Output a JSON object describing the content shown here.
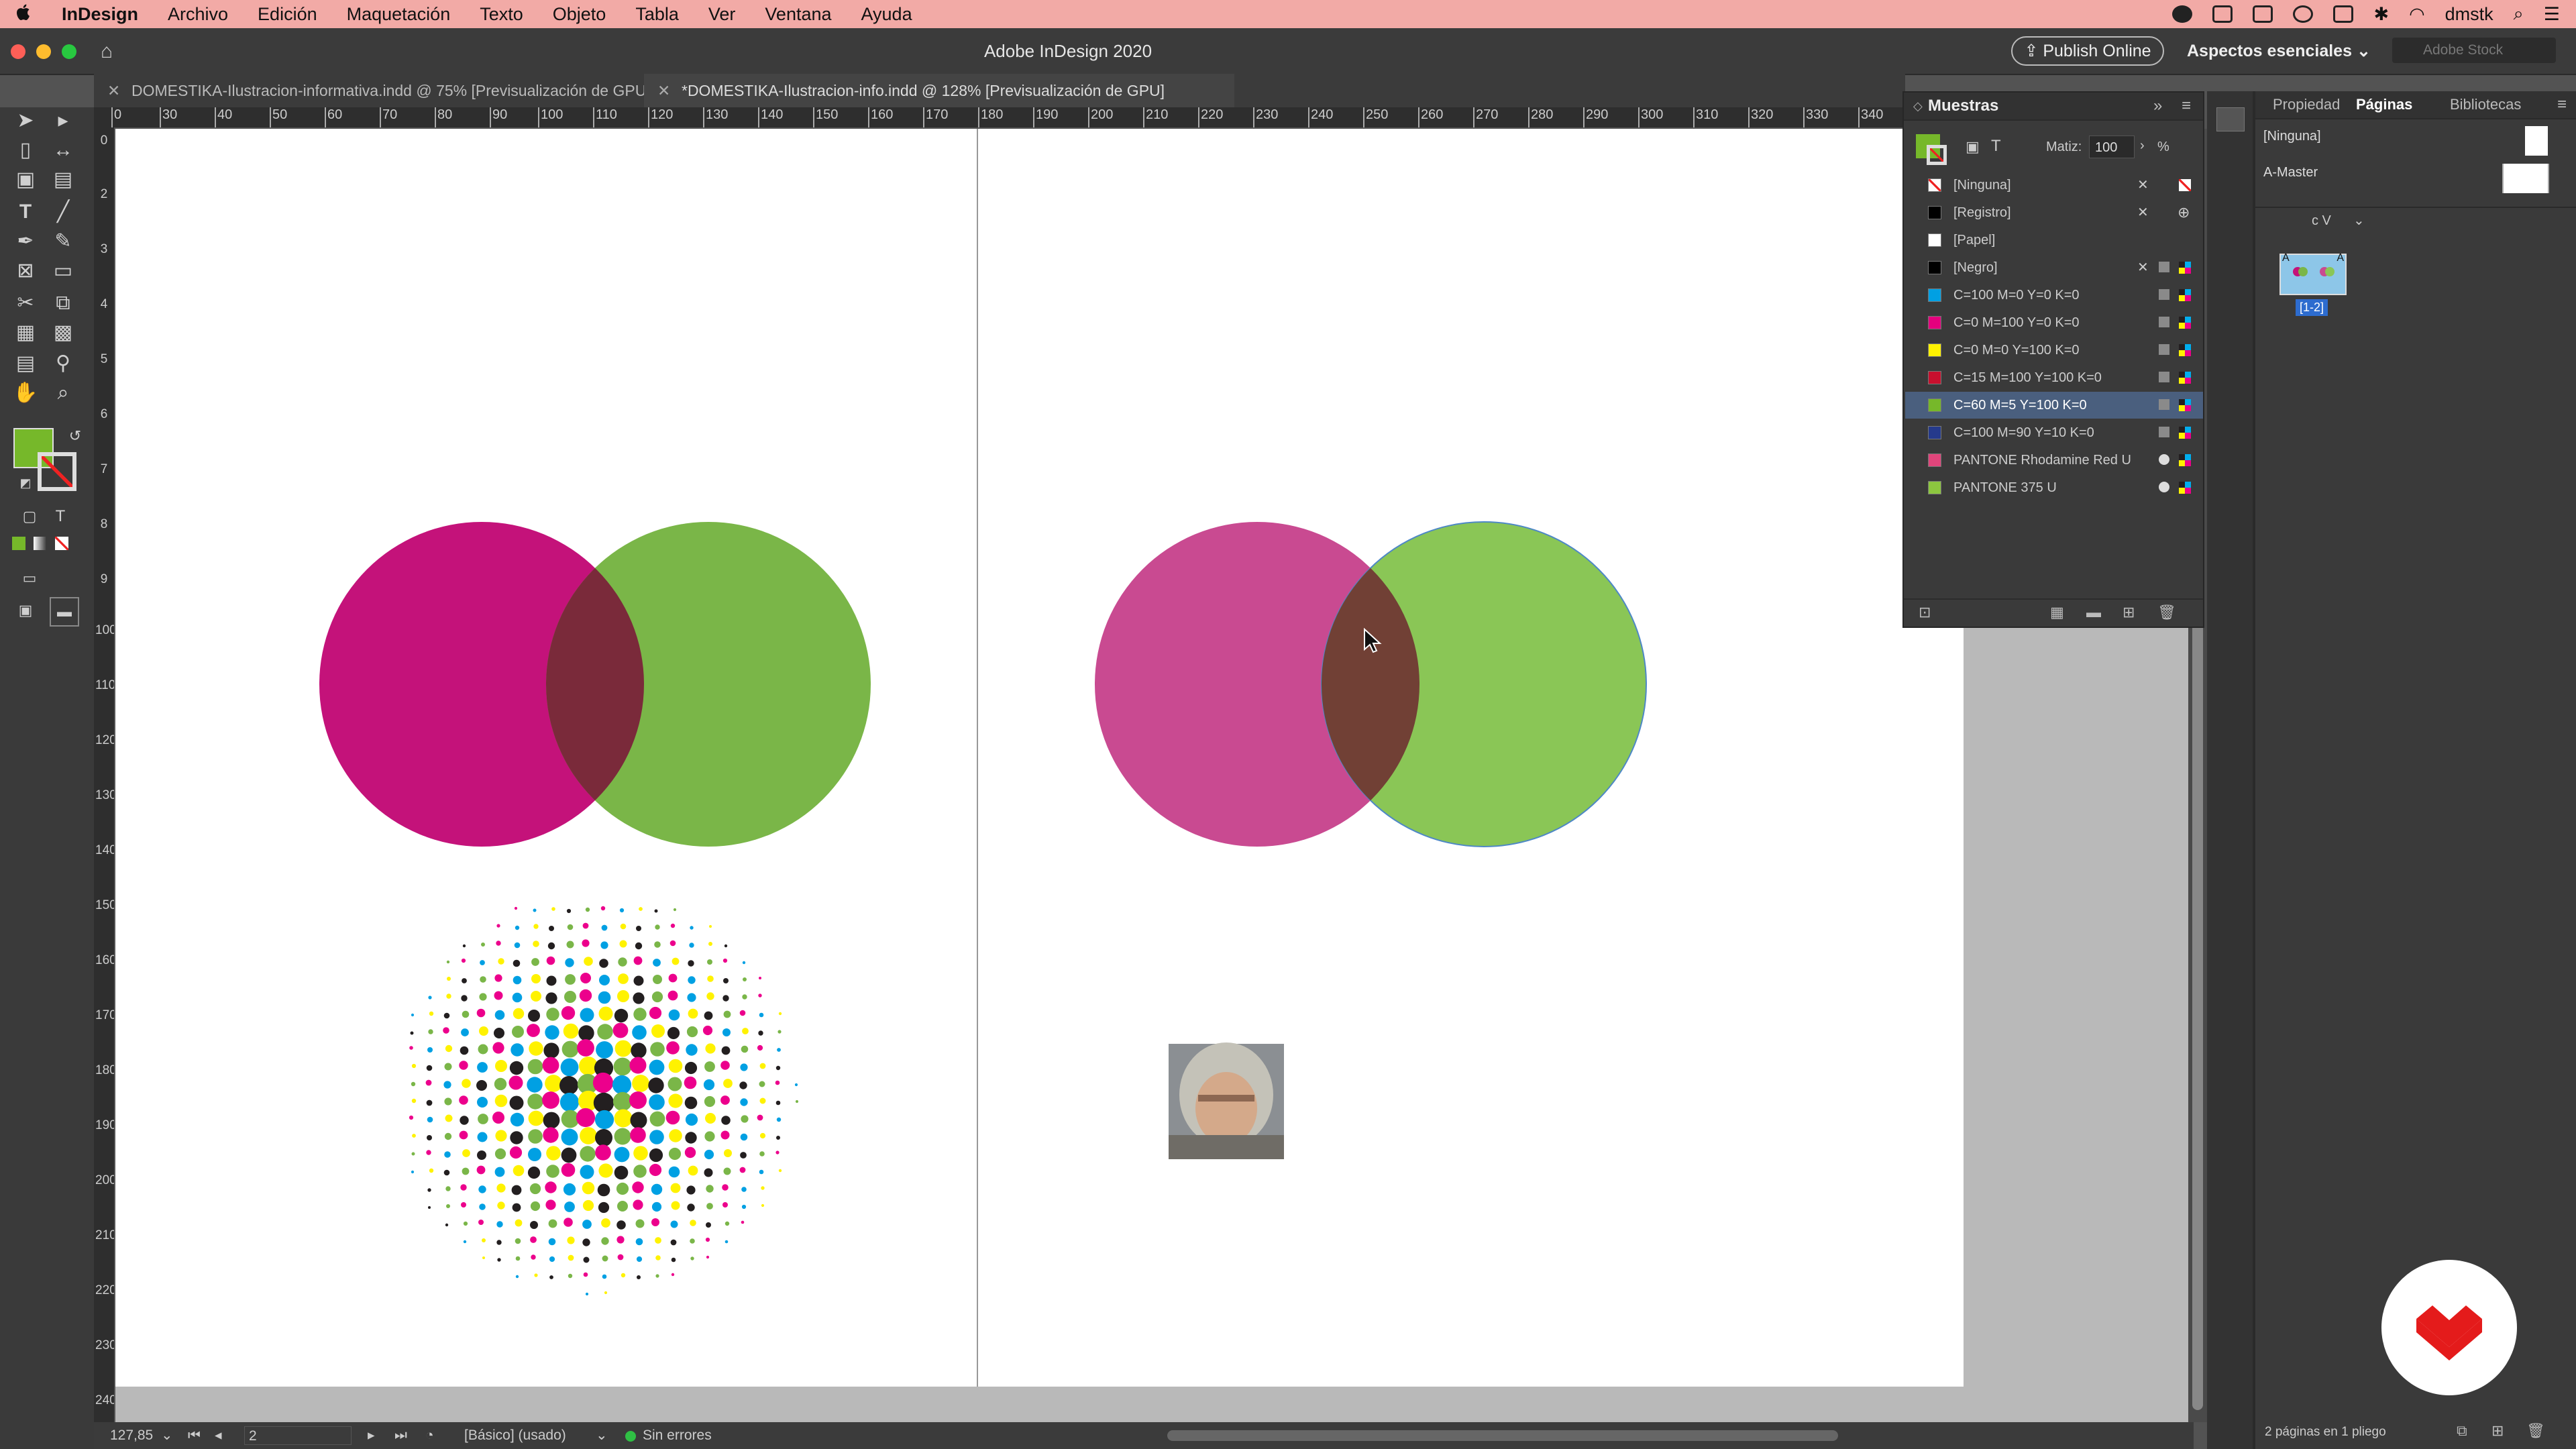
{
  "menubar": {
    "apple": "",
    "app_name": "InDesign",
    "items": [
      "Archivo",
      "Edición",
      "Maquetación",
      "Texto",
      "Objeto",
      "Tabla",
      "Ver",
      "Ventana",
      "Ayuda"
    ],
    "user": "dmstk"
  },
  "appbar": {
    "title": "Adobe InDesign 2020",
    "publish_label": "Publish Online",
    "workspace": "Aspectos esenciales",
    "stock_placeholder": "Adobe Stock"
  },
  "tabs": [
    {
      "label": "DOMESTIKA-Ilustracion-informativa.indd @ 75% [Previsualización de GPU]"
    },
    {
      "label": "*DOMESTIKA-Ilustracion-info.indd @ 128% [Previsualización de GPU]"
    }
  ],
  "hruler": [
    "0",
    "30",
    "40",
    "50",
    "60",
    "70",
    "80",
    "90",
    "100",
    "110",
    "120",
    "130",
    "140",
    "150",
    "160",
    "170",
    "180",
    "190",
    "200",
    "210",
    "220",
    "230",
    "240",
    "250",
    "260",
    "270",
    "280",
    "290",
    "300",
    "310",
    "320",
    "330",
    "340"
  ],
  "vruler": [
    "0",
    "2",
    "3",
    "4",
    "5",
    "6",
    "7",
    "8",
    "9",
    "100",
    "110",
    "120",
    "130",
    "140",
    "150",
    "160",
    "170",
    "180",
    "190",
    "200",
    "210",
    "220",
    "230",
    "240"
  ],
  "swatches": {
    "title": "Muestras",
    "tint_label": "Matiz:",
    "tint_value": "100",
    "tint_unit": "%",
    "items": [
      {
        "name": "[Ninguna]",
        "color": "none"
      },
      {
        "name": "[Registro]",
        "color": "#000000"
      },
      {
        "name": "[Papel]",
        "color": "#ffffff"
      },
      {
        "name": "[Negro]",
        "color": "#000000"
      },
      {
        "name": "C=100 M=0 Y=0 K=0",
        "color": "#00a0e3"
      },
      {
        "name": "C=0 M=100 Y=0 K=0",
        "color": "#e5007e"
      },
      {
        "name": "C=0 M=0 Y=100 K=0",
        "color": "#fff200"
      },
      {
        "name": "C=15 M=100 Y=100 K=0",
        "color": "#c8102e"
      },
      {
        "name": "C=60 M=5 Y=100 K=0",
        "color": "#76b82a"
      },
      {
        "name": "C=100 M=90 Y=10 K=0",
        "color": "#253a8c"
      },
      {
        "name": "PANTONE Rhodamine Red U",
        "color": "#e0457b"
      },
      {
        "name": "PANTONE 375 U",
        "color": "#8cc63f"
      }
    ]
  },
  "pages_panel": {
    "tabs": [
      "Propiedad",
      "Páginas",
      "Bibliotecas"
    ],
    "none_master": "[Ninguna]",
    "a_master": "A-Master",
    "view_label": "c V",
    "spread_label": "[1-2]",
    "footer": "2 páginas en 1 pliego"
  },
  "status": {
    "zoom": "127,85",
    "page": "2",
    "style": "[Básico] (usado)",
    "preflight": "Sin errores"
  },
  "colors": {
    "magenta": "#c4127a",
    "green": "#7ab648",
    "overlap": "#7a2a3a",
    "rhodamine": "#c94a91",
    "green2": "#8ac656",
    "overlap2": "#714035",
    "accent": "#4a5f7e"
  },
  "icons": {
    "apple": "apple-icon",
    "home": "home-icon",
    "search": "search-icon",
    "cursor": "mouse-pointer-icon",
    "logo": "domestika-logo"
  }
}
